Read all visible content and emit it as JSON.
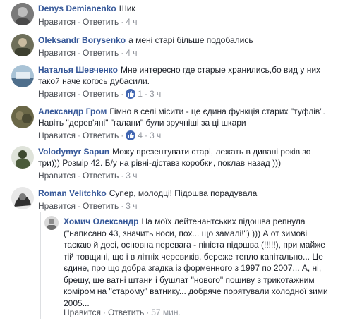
{
  "comments": [
    {
      "author": "Denys Demianenko",
      "text": "Шик",
      "like": "Нравится",
      "reply": "Ответить",
      "time": "4 ч",
      "avatar_color": "#6b6b6b"
    },
    {
      "author": "Oleksandr Borysenko",
      "text": "а мені старі більше подобались",
      "like": "Нравится",
      "reply": "Ответить",
      "time": "4 ч",
      "avatar_color": "#5a5f4c"
    },
    {
      "author": "Наталья Шевченко",
      "text": "Мне интересно где старые хранились,бо вид у них такой наче когось дубасили.",
      "like": "Нравится",
      "reply": "Ответить",
      "reactions": "1",
      "time": "3 ч",
      "avatar_color": "#8aa3b8"
    },
    {
      "author": "Александр Гром",
      "text": "Гімно в селі місити - це єдина функція старих \"туфлів\". Навіть \"дерев'яні\" \"галани\" були зручніші за ці шкари",
      "like": "Нравится",
      "reply": "Ответить",
      "reactions": "4",
      "time": "3 ч",
      "avatar_color": "#5c5a3e"
    },
    {
      "author": "Volodymyr Sapun",
      "text": "Можу презентувати старі, лежать в дивані років зо три))) Розмір 42. Б/у на рівні-діставз коробки, поклав назад )))",
      "like": "Нравится",
      "reply": "Ответить",
      "time": "3 ч",
      "avatar_color": "#4a5a3a"
    },
    {
      "author": "Roman Velitchko",
      "text": "Супер, молодці! Підошва порадувала",
      "like": "Нравится",
      "reply": "Ответить",
      "time": "3 ч",
      "avatar_color": "#3c3c3c"
    }
  ],
  "reply": {
    "author": "Хомич Олександр",
    "text": "На моїх лейтенантських підошва репнула (\"написано 43, значить носи, пох... що замалі!\") ))) А от зимові таскаю й досі, основна перевага - пініста підошва (!!!!!), при майже тій товщині, що і в літніх черевиків, береже тепло капітально... Це єдине, про що добра згадка із форменного з 1997 по 2007... А, ні, брешу, ще ватні штани і бушлат \"нового\" пошиву з трикотажним коміром на \"старому\" ватнику... добряче порятували холодної зими 2005...",
    "like": "Нравится",
    "reply": "Ответить",
    "time": "57 мин.",
    "avatar_color": "#9a9a9a"
  },
  "colors": {
    "author": "#365899",
    "meta": "#90949c",
    "like_badge": "#4267b2"
  },
  "icons": {
    "like_badge": "thumbs-up-icon"
  }
}
